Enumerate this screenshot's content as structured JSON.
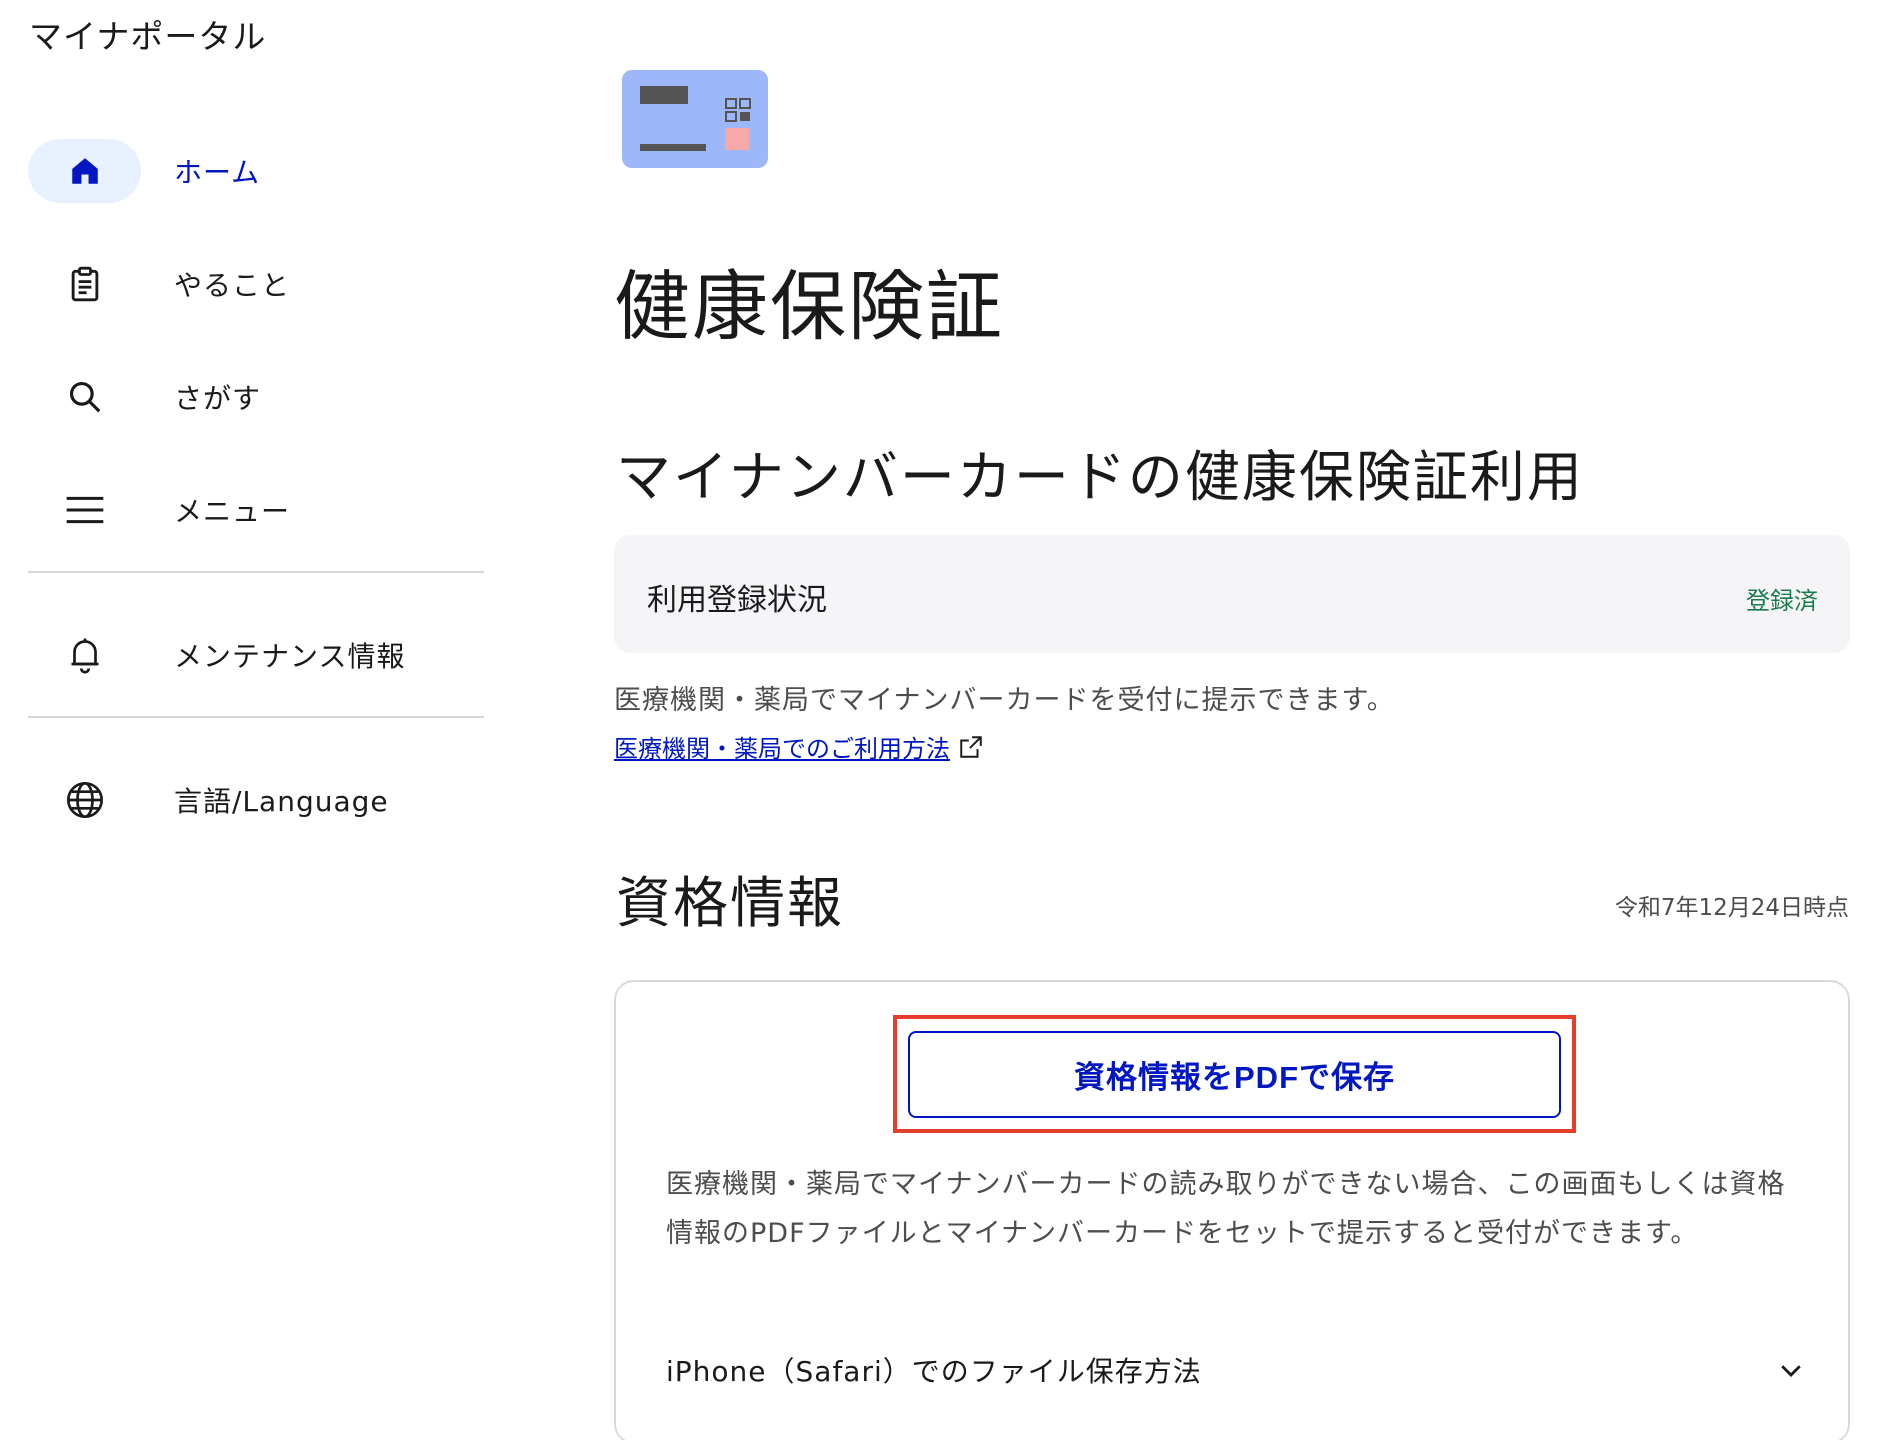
{
  "app": {
    "title": "マイナポータル"
  },
  "sidebar": {
    "items": [
      {
        "label": "ホーム",
        "icon": "home-icon",
        "active": true
      },
      {
        "label": "やること",
        "icon": "clipboard-icon"
      },
      {
        "label": "さがす",
        "icon": "search-icon"
      },
      {
        "label": "メニュー",
        "icon": "menu-icon"
      },
      {
        "label": "メンテナンス情報",
        "icon": "bell-icon"
      },
      {
        "label": "言語/Language",
        "icon": "globe-icon"
      }
    ]
  },
  "main": {
    "page_title": "健康保険証",
    "section_title": "マイナンバーカードの健康保険証利用",
    "status": {
      "label": "利用登録状況",
      "value": "登録済"
    },
    "description": "医療機関・薬局でマイナンバーカードを受付に提示できます。",
    "usage_link": "医療機関・薬局でのご利用方法",
    "qualification": {
      "title": "資格情報",
      "as_of": "令和7年12月24日時点",
      "pdf_button": "資格情報をPDFで保存",
      "description": "医療機関・薬局でマイナンバーカードの読み取りができない場合、この画面もしくは資格情報のPDFファイルとマイナンバーカードをセットで提示すると受付ができます。",
      "accordion_label": "iPhone（Safari）でのファイル保存方法"
    }
  },
  "colors": {
    "accent": "#0017c1",
    "active_bg": "#e8f1fe",
    "status_green": "#197a4b",
    "highlight_red": "#e53e2a",
    "card_blue": "#9db7f9"
  }
}
